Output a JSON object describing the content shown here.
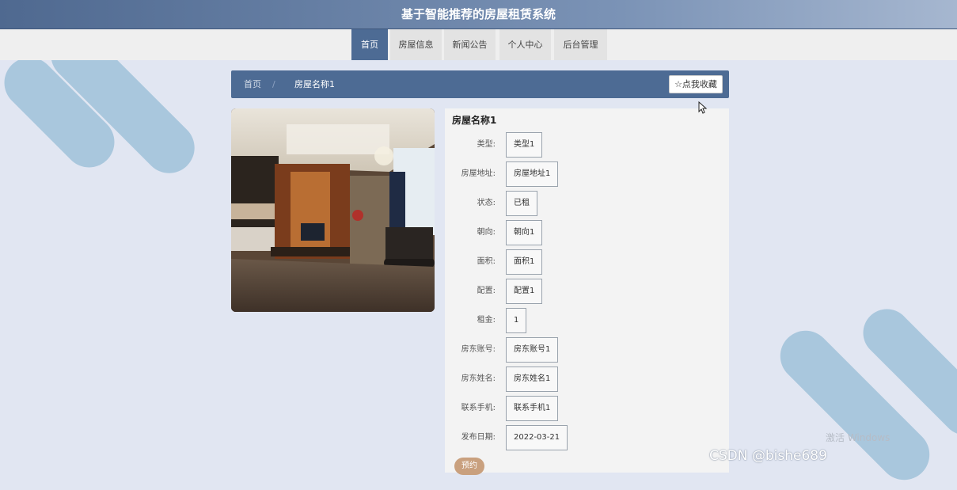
{
  "site": {
    "title": "基于智能推荐的房屋租赁系统"
  },
  "nav": [
    {
      "label": "首页",
      "active": true
    },
    {
      "label": "房屋信息",
      "active": false
    },
    {
      "label": "新闻公告",
      "active": false
    },
    {
      "label": "个人中心",
      "active": false
    },
    {
      "label": "后台管理",
      "active": false
    }
  ],
  "breadcrumb": {
    "home": "首页",
    "separator": "/",
    "current": "房屋名称1"
  },
  "favorite_button": {
    "label": "☆点我收藏"
  },
  "detail": {
    "title": "房屋名称1",
    "fields": [
      {
        "label": "类型:",
        "value": "类型1"
      },
      {
        "label": "房屋地址:",
        "value": "房屋地址1"
      },
      {
        "label": "状态:",
        "value": "已租"
      },
      {
        "label": "朝向:",
        "value": "朝向1"
      },
      {
        "label": "面积:",
        "value": "面积1"
      },
      {
        "label": "配置:",
        "value": "配置1"
      },
      {
        "label": "租金:",
        "value": "1"
      },
      {
        "label": "房东账号:",
        "value": "房东账号1"
      },
      {
        "label": "房东姓名:",
        "value": "房东姓名1"
      },
      {
        "label": "联系手机:",
        "value": "联系手机1"
      },
      {
        "label": "发布日期:",
        "value": "2022-03-21"
      }
    ],
    "book_label": "预约"
  },
  "os_overlay": {
    "activate": "激活 Windows"
  },
  "watermark": "CSDN @bishe689",
  "colors": {
    "header": "#4d6b94",
    "background": "#e1e6f2",
    "decor": "#a9c7dd",
    "book": "#c9a07e"
  }
}
